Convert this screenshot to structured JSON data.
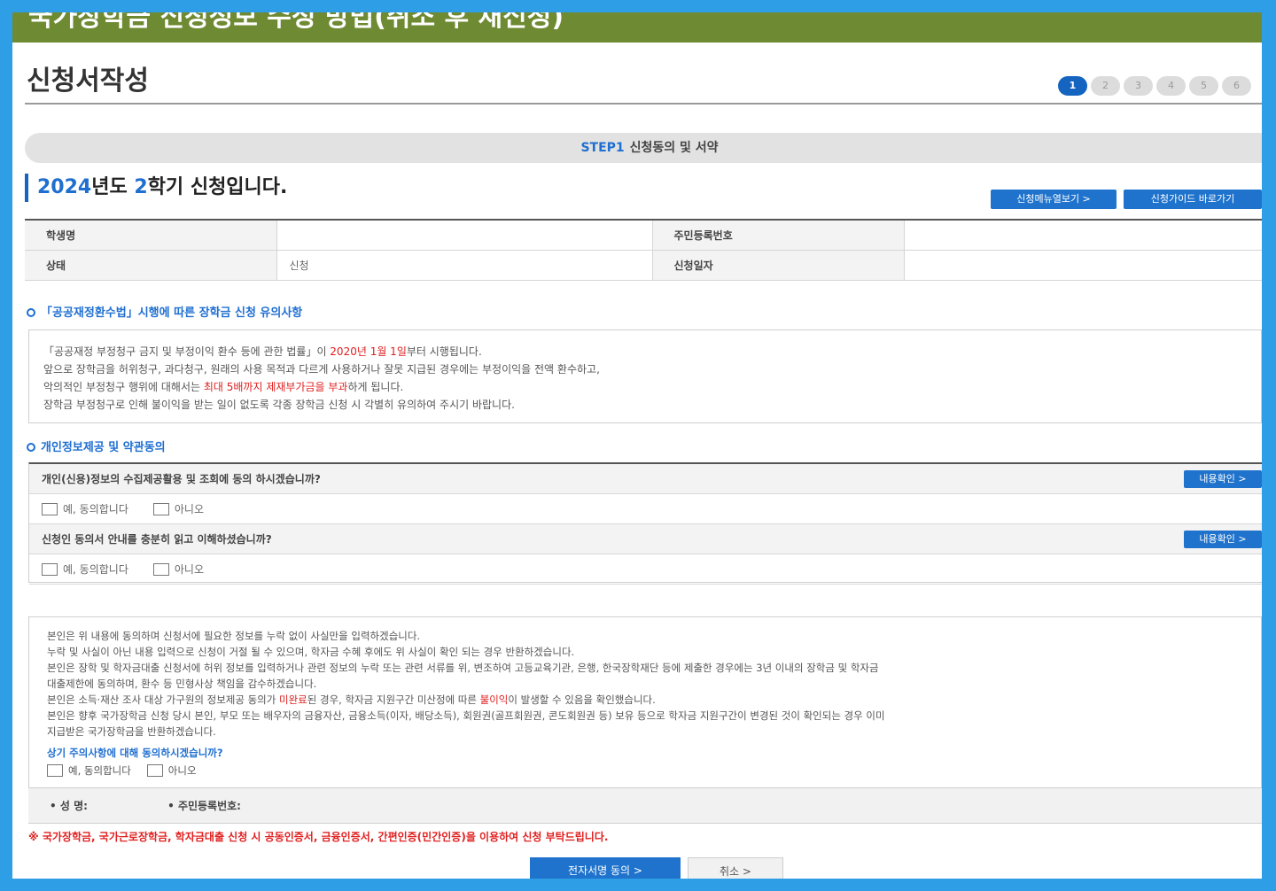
{
  "banner": {
    "title": "국가장학금 신청정보 수정 방법(취소 후 재신청)"
  },
  "header": {
    "page_title": "신청서작성"
  },
  "steps": [
    "1",
    "2",
    "3",
    "4",
    "5",
    "6"
  ],
  "step_bar": {
    "code": "STEP1",
    "label": "신청동의 및 서약"
  },
  "semester": {
    "year": "2024",
    "year_suffix": "년도 ",
    "term": "2",
    "term_suffix": "학기 신청입니다."
  },
  "top_buttons": {
    "menu": "신청메뉴열보기  >",
    "guide": "신청가이드 바로가기"
  },
  "info_table": {
    "student_name_label": "학생명",
    "student_name_value": "",
    "resident_no_label": "주민등록번호",
    "resident_no_value": "",
    "status_label": "상태",
    "status_value": "신청",
    "apply_date_label": "신청일자",
    "apply_date_value": ""
  },
  "notice": {
    "title": "「공공재정환수법」시행에 따른 장학금 신청 유의사항",
    "line1_a": "「공공재정 부정청구 금지 및 부정이익 환수 등에 관한 법률」이 ",
    "line1_red": "2020년 1월 1일",
    "line1_b": "부터 시행됩니다.",
    "line2": "앞으로 장학금을 허위청구, 과다청구, 원래의 사용 목적과 다르게 사용하거나 잘못 지급된 경우에는 부정이익을 전액 환수하고,",
    "line3_a": "악의적인 부정청구 행위에 대해서는 ",
    "line3_red": "최대 5배까지 제재부가금을 부과",
    "line3_b": "하게 됩니다.",
    "line4": "장학금 부정청구로 인해 불이익을 받는 일이 없도록 각종 장학금 신청 시 각별히 유의하여 주시기 바랍니다."
  },
  "consent": {
    "title": "개인정보제공 및 약관동의",
    "q1": "개인(신용)정보의 수집제공활용 및 조회에 동의 하시겠습니까?",
    "q2": "신청인 동의서 안내를 충분히 읽고 이해하셨습니까?",
    "yes": "예, 동의합니다",
    "no": "아니오",
    "detail": "내용확인  >"
  },
  "agreement": {
    "l1": "본인은 위 내용에 동의하며 신청서에 필요한 정보를 누락 없이 사실만을 입력하겠습니다.",
    "l2": "누락 및 사실이 아닌 내용 입력으로 신청이 거절 될 수 있으며, 학자금 수혜 후에도 위 사실이 확인 되는 경우 반환하겠습니다.",
    "l3": "본인은 장학 및 학자금대출 신청서에 허위 정보를 입력하거나 관련 정보의 누락 또는 관련 서류를 위, 변조하여 고등교육기관, 은행, 한국장학재단 등에 제출한 경우에는 3년 이내의 장학금 및 학자금",
    "l4": "대출제한에 동의하며, 환수 등 민형사상 책임을 감수하겠습니다.",
    "l5_a": "본인은 소득·재산 조사 대상 가구원의 정보제공 동의가 ",
    "l5_red1": "미완료",
    "l5_b": "된 경우, 학자금 지원구간 미산정에 따른 ",
    "l5_red2": "불이익",
    "l5_c": "이 발생할 수 있음을 확인했습니다.",
    "l6": "본인은 향후 국가장학금 신청 당시 본인, 부모 또는 배우자의 금융자산, 금융소득(이자, 배당소득), 회원권(골프회원권, 콘도회원권 등) 보유 등으로 학자금 지원구간이 변경된 것이 확인되는 경우 이미",
    "l7": "지급받은 국가장학금을 반환하겠습니다.",
    "question": "상기 주의사항에 대해 동의하시겠습니까?",
    "yes": "예, 동의합니다",
    "no": "아니오"
  },
  "sign_bar": {
    "name": "• 성  명:",
    "resident_no": "• 주민등록번호:"
  },
  "warning": "※ 국가장학금, 국가근로장학금, 학자금대출 신청 시 공동인증서, 금융인증서, 간편인증(민간인증)을 이용하여 신청 부탁드립니다.",
  "buttons": {
    "sign": "전자서명 동의      >",
    "cancel": "취소      >"
  },
  "colors": {
    "accent_blue": "#1f73cc",
    "banner_green": "#6e8a32",
    "warning_red": "#e02020",
    "frame_blue": "#2e9fe6"
  }
}
